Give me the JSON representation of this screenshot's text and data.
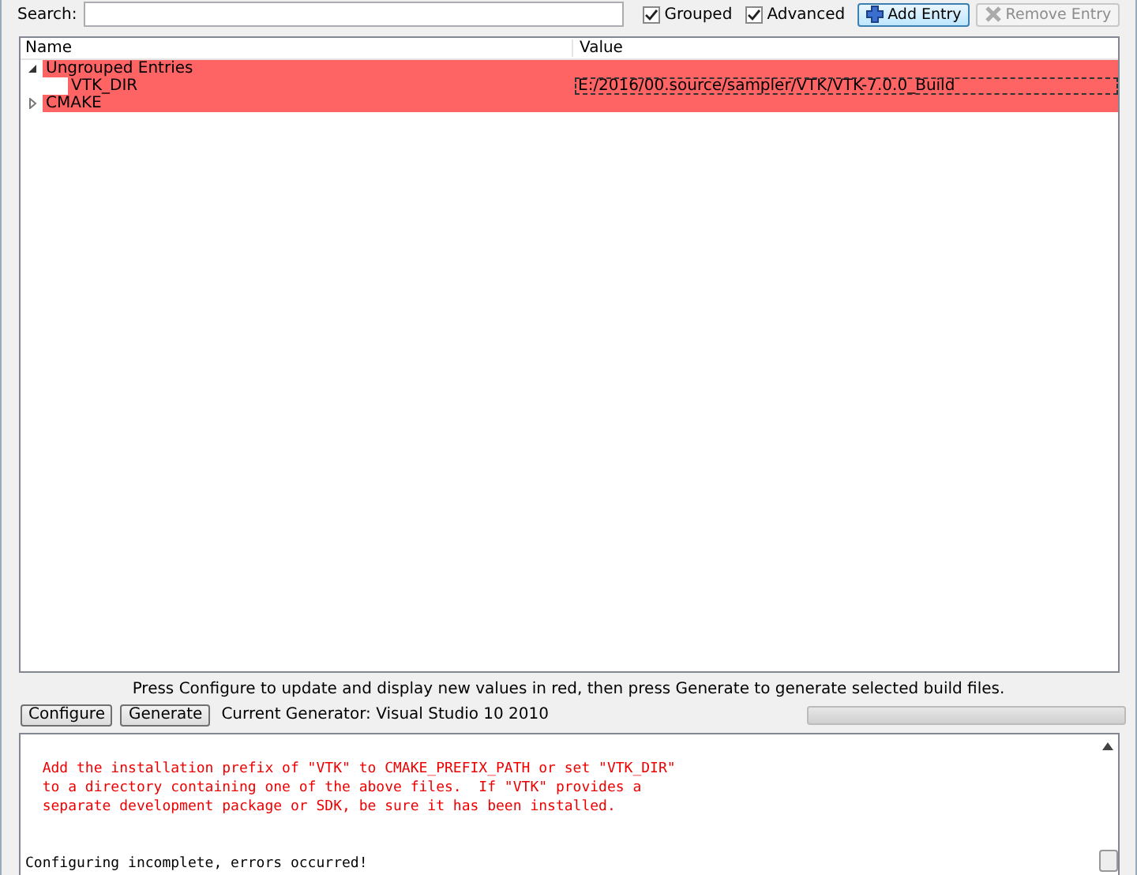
{
  "search": {
    "label": "Search:"
  },
  "options": [
    {
      "label": "Grouped",
      "checked": true
    },
    {
      "label": "Advanced",
      "checked": true
    }
  ],
  "toolbar_buttons": [
    {
      "label": "Add Entry",
      "kind": "add",
      "disabled": false
    },
    {
      "label": "Remove Entry",
      "kind": "remove",
      "disabled": true
    }
  ],
  "table": {
    "columns": [
      "Name",
      "Value"
    ],
    "rows": [
      {
        "name": "Ungrouped Entries",
        "value": "",
        "expanded": true,
        "children": [
          {
            "name": "VTK_DIR",
            "value": "E:/2016/00.source/sampler/VTK/VTK-7.0.0_Build",
            "selected": true
          }
        ]
      },
      {
        "name": "CMAKE",
        "value": "",
        "expanded": false,
        "children": []
      }
    ]
  },
  "hint": "Press Configure to update and display new values in red, then press Generate to generate selected build files.",
  "actions": [
    "Configure",
    "Generate"
  ],
  "generator": "Current Generator: Visual Studio 10 2010",
  "progress": {
    "level": 0
  },
  "output": [
    {
      "text": "  Add the installation prefix of \"VTK\" to CMAKE_PREFIX_PATH or set \"VTK_DIR\"",
      "kind": "error"
    },
    {
      "text": "  to a directory containing one of the above files.  If \"VTK\" provides a",
      "kind": "error"
    },
    {
      "text": "  separate development package or SDK, be sure it has been installed.",
      "kind": "error"
    },
    {
      "kind": "blank"
    },
    {
      "kind": "blank"
    },
    {
      "text": "Configuring incomplete, errors occurred!",
      "kind": "normal"
    }
  ]
}
